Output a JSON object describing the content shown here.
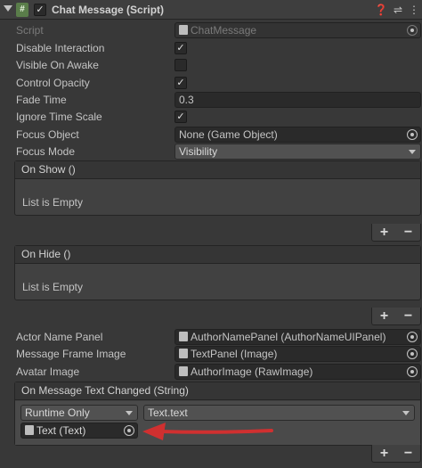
{
  "component": {
    "title": "Chat Message (Script)",
    "icons": [
      "help-icon",
      "preset-icon",
      "more-icon"
    ]
  },
  "fields": {
    "script": {
      "label": "Script",
      "value": "ChatMessage"
    },
    "disable_interaction": {
      "label": "Disable Interaction",
      "checked": true
    },
    "visible_on_awake": {
      "label": "Visible On Awake",
      "checked": false
    },
    "control_opacity": {
      "label": "Control Opacity",
      "checked": true
    },
    "fade_time": {
      "label": "Fade Time",
      "value": "0.3"
    },
    "ignore_time_scale": {
      "label": "Ignore Time Scale",
      "checked": true
    },
    "focus_object": {
      "label": "Focus Object",
      "value": "None (Game Object)"
    },
    "focus_mode": {
      "label": "Focus Mode",
      "value": "Visibility"
    },
    "actor_name_panel": {
      "label": "Actor Name Panel",
      "value": "AuthorNamePanel (AuthorNameUIPanel)"
    },
    "message_frame_image": {
      "label": "Message Frame Image",
      "value": "TextPanel (Image)"
    },
    "avatar_image": {
      "label": "Avatar Image",
      "value": "AuthorImage (RawImage)"
    }
  },
  "events": {
    "on_show": {
      "title": "On Show ()",
      "empty_text": "List is Empty"
    },
    "on_hide": {
      "title": "On Hide ()",
      "empty_text": "List is Empty"
    },
    "on_message_text_changed": {
      "title": "On Message Text Changed (String)",
      "runtime": "Runtime Only",
      "function": "Text.text",
      "target_object": "Text (Text)"
    }
  },
  "buttons": {
    "plus": "+",
    "minus": "−"
  },
  "colors": {
    "background": "#383838",
    "annotation_arrow": "#d03030"
  }
}
